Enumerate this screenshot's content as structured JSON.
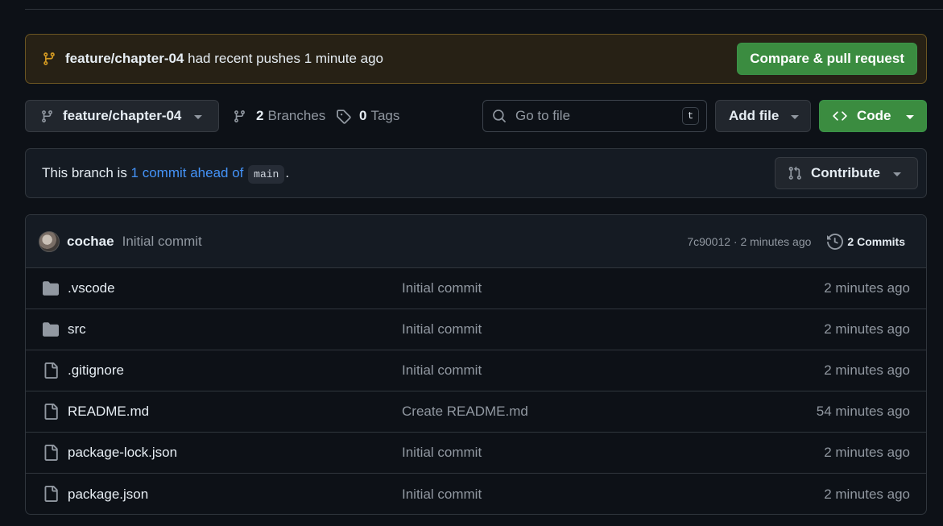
{
  "banner": {
    "branch": "feature/chapter-04",
    "message": " had recent pushes 1 minute ago",
    "button": "Compare & pull request",
    "icon": "git-branch-icon"
  },
  "toolbar": {
    "branch_selector": "feature/chapter-04",
    "branches_count": "2",
    "branches_label": "Branches",
    "tags_count": "0",
    "tags_label": "Tags",
    "search_placeholder": "Go to file",
    "search_shortcut": "t",
    "add_file": "Add file",
    "code": "Code"
  },
  "branch_status": {
    "prefix": "This branch is ",
    "link": "1 commit ahead of",
    "base": "main",
    "suffix": ".",
    "contribute": "Contribute"
  },
  "latest_commit": {
    "author": "cochae",
    "message": "Initial commit",
    "meta": "7c90012 · 2 minutes ago",
    "commits_label": "2 Commits"
  },
  "files": [
    {
      "type": "folder",
      "name": ".vscode",
      "commit": "Initial commit",
      "age": "2 minutes ago"
    },
    {
      "type": "folder",
      "name": "src",
      "commit": "Initial commit",
      "age": "2 minutes ago"
    },
    {
      "type": "file",
      "name": ".gitignore",
      "commit": "Initial commit",
      "age": "2 minutes ago"
    },
    {
      "type": "file",
      "name": "README.md",
      "commit": "Create README.md",
      "age": "54 minutes ago"
    },
    {
      "type": "file",
      "name": "package-lock.json",
      "commit": "Initial commit",
      "age": "2 minutes ago"
    },
    {
      "type": "file",
      "name": "package.json",
      "commit": "Initial commit",
      "age": "2 minutes ago"
    }
  ],
  "colors": {
    "background": "#0d1117",
    "accent_green": "#3b8c40",
    "link_blue": "#4493f8",
    "banner_border": "#6b5522",
    "muted_text": "#9198a1"
  }
}
